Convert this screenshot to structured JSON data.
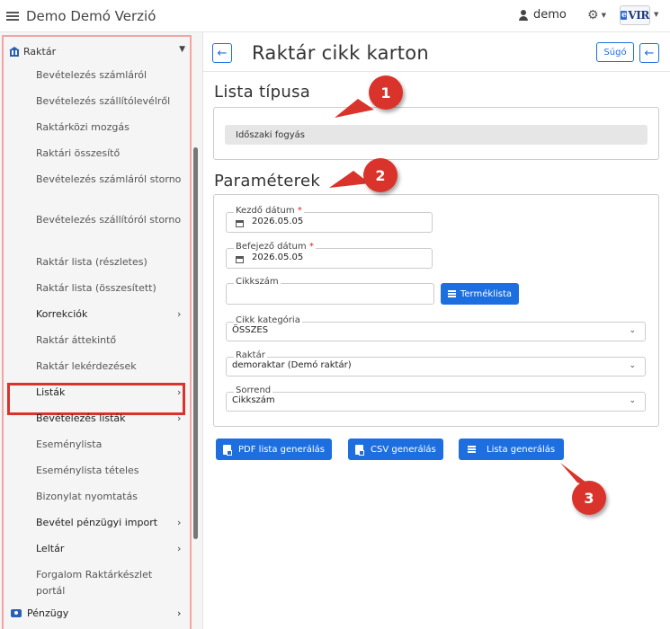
{
  "topbar": {
    "app_title": "Demo Demó Verzió",
    "username": "demo",
    "logo_text": "VIR",
    "logo_badge": "e"
  },
  "sidebar": {
    "section_label": "Raktár",
    "items": [
      {
        "label": "Bevételezés számláról",
        "bold": false
      },
      {
        "label": "Bevételezés szállítólevélről",
        "bold": false
      },
      {
        "label": "Raktárközi mozgás",
        "bold": false
      },
      {
        "label": "Raktári összesítő",
        "bold": false
      },
      {
        "label": "Bevételezés számláról storno",
        "bold": false
      },
      {
        "label": "Bevételezés szállítóról storno",
        "bold": false
      },
      {
        "label": "Raktár lista (részletes)",
        "bold": false
      },
      {
        "label": "Raktár lista (összesített)",
        "bold": false
      },
      {
        "label": "Korrekciók",
        "bold": true,
        "has_arrow": true
      },
      {
        "label": "Raktár áttekintő",
        "bold": false
      },
      {
        "label": "Raktár lekérdezések",
        "bold": false,
        "highlighted": true
      },
      {
        "label": "Listák",
        "bold": true,
        "has_arrow": true
      },
      {
        "label": "Bevételezés listák",
        "bold": true,
        "has_arrow": true
      },
      {
        "label": "Eseménylista",
        "bold": false
      },
      {
        "label": "Eseménylista tételes",
        "bold": false
      },
      {
        "label": "Bizonylat nyomtatás",
        "bold": false
      },
      {
        "label": "Bevétel pénzügyi import",
        "bold": true,
        "has_arrow": true
      },
      {
        "label": "Leltár",
        "bold": true,
        "has_arrow": true
      },
      {
        "label": "Forgalom Raktárkészlet portál",
        "bold": false
      }
    ],
    "bottom_section": "Pénzügy"
  },
  "main": {
    "page_title": "Raktár cikk karton",
    "help_label": "Súgó",
    "list_type_title": "Lista típusa",
    "list_type_value": "Időszaki fogyás",
    "params_title": "Paraméterek",
    "fields": {
      "start_date_label": "Kezdő dátum",
      "start_date_value": "2026.05.05",
      "end_date_label": "Befejező dátum",
      "end_date_value": "2026.05.05",
      "item_no_label": "Cikkszám",
      "item_no_value": "",
      "product_list_button": "Terméklista",
      "category_label": "Cikk kategória",
      "category_value": "ÖSSZES",
      "warehouse_label": "Raktár",
      "warehouse_value": "demoraktar (Demó raktár)",
      "order_label": "Sorrend",
      "order_value": "Cikkszám"
    },
    "actions": {
      "pdf_label": "PDF lista generálás",
      "csv_label": "CSV generálás",
      "list_label": "Lista generálás"
    }
  },
  "callouts": [
    "1",
    "2",
    "3"
  ],
  "colors": {
    "primary": "#1d6fe0",
    "callout": "#d9332b",
    "highlight_border": "#d9332b",
    "sidebar_outline": "#f5a3a3"
  }
}
